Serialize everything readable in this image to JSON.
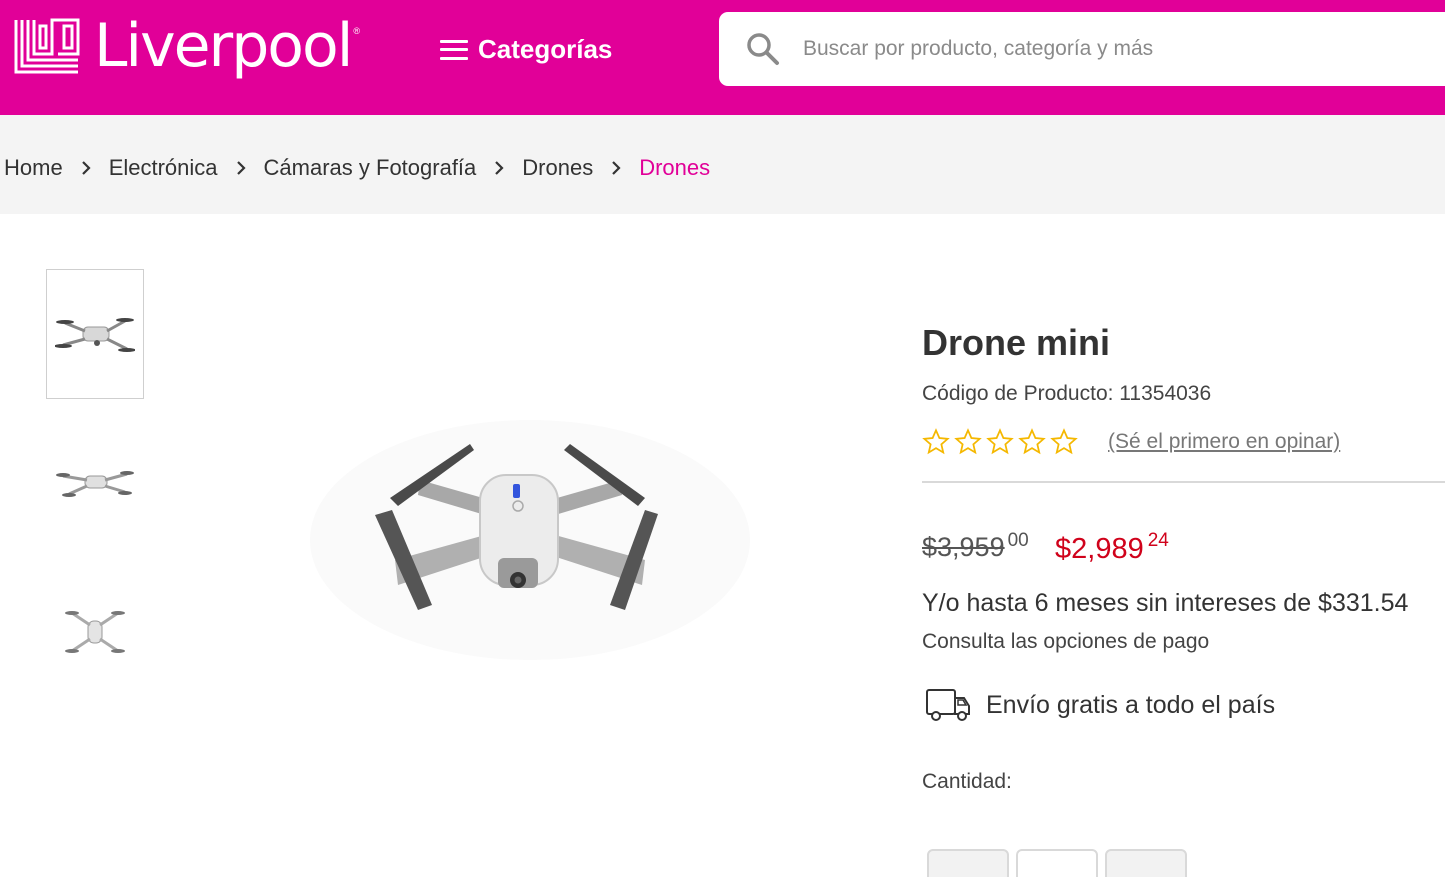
{
  "header": {
    "logo_text": "Liverpool",
    "logo_reg": "®",
    "categories_label": "Categorías",
    "search_placeholder": "Buscar por producto, categoría y más",
    "brand_color": "#e10098"
  },
  "breadcrumb": [
    {
      "label": "Home",
      "active": false
    },
    {
      "label": "Electrónica",
      "active": false
    },
    {
      "label": "Cámaras y Fotografía",
      "active": false
    },
    {
      "label": "Drones",
      "active": false
    },
    {
      "label": "Drones",
      "active": true
    }
  ],
  "gallery": {
    "thumbnails": [
      {
        "view": "drone-angle-view",
        "selected": true
      },
      {
        "view": "drone-side-view",
        "selected": false
      },
      {
        "view": "drone-top-view",
        "selected": false
      }
    ]
  },
  "product": {
    "title": "Drone mini",
    "code": "Código de Producto: 11354036",
    "rating": {
      "stars": 5,
      "filled": 0,
      "review_link": "(Sé el primero en opinar)",
      "star_color": "#f5b800"
    },
    "price_old": {
      "main": "$3,959",
      "cents": "00"
    },
    "price_new": {
      "main": "$2,989",
      "cents": "24",
      "color": "#d0021b"
    },
    "installments": "Y/o hasta 6 meses sin intereses de $331.54",
    "payment_options": "Consulta las opciones de pago",
    "shipping": "Envío gratis a todo el país",
    "quantity_label": "Cantidad:"
  }
}
